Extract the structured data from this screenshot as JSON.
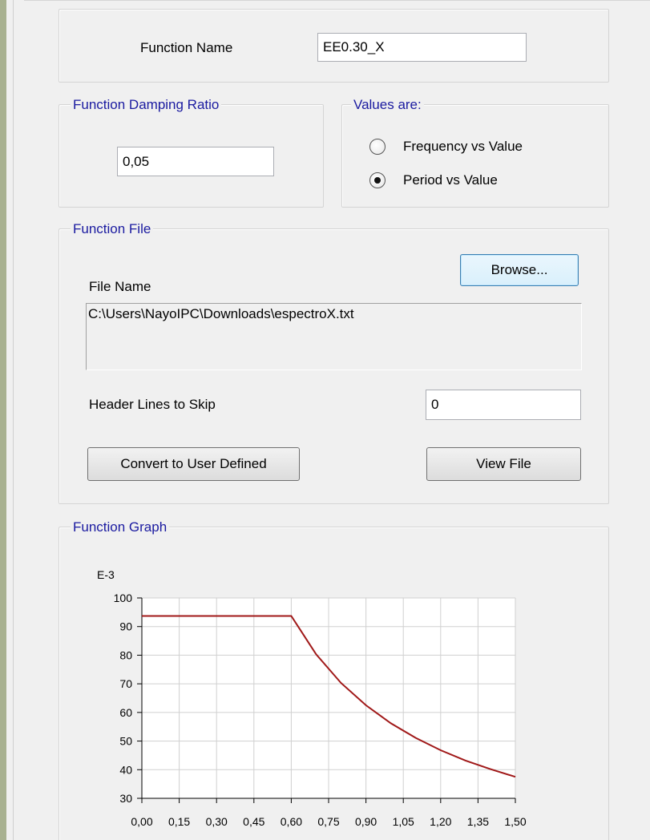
{
  "function_name": {
    "label": "Function Name",
    "value": "EE0.30_X"
  },
  "damping": {
    "title": "Function Damping Ratio",
    "value": "0,05"
  },
  "values_are": {
    "title": "Values are:",
    "options": [
      {
        "label": "Frequency vs Value",
        "selected": false
      },
      {
        "label": "Period vs Value",
        "selected": true
      }
    ]
  },
  "function_file": {
    "title": "Function File",
    "browse_label": "Browse...",
    "file_name_label": "File Name",
    "file_name_value": "C:\\Users\\NayoIPC\\Downloads\\espectroX.txt",
    "header_lines_label": "Header Lines to Skip",
    "header_lines_value": "0",
    "convert_label": "Convert to User Defined",
    "view_file_label": "View File"
  },
  "function_graph": {
    "title": "Function Graph"
  },
  "chart_data": {
    "type": "line",
    "scale_label": "E-3",
    "x_ticks": [
      "0,00",
      "0,15",
      "0,30",
      "0,45",
      "0,60",
      "0,75",
      "0,90",
      "1,05",
      "1,20",
      "1,35",
      "1,50"
    ],
    "x_tick_values": [
      0,
      0.15,
      0.3,
      0.45,
      0.6,
      0.75,
      0.9,
      1.05,
      1.2,
      1.35,
      1.5
    ],
    "y_ticks": [
      "100",
      "90",
      "80",
      "70",
      "60",
      "50",
      "40",
      "30"
    ],
    "y_tick_values": [
      100,
      90,
      80,
      70,
      60,
      50,
      40,
      30
    ],
    "xlim": [
      0,
      1.5
    ],
    "ylim": [
      30,
      100
    ],
    "grid": true,
    "line_color": "#a01818",
    "series": [
      {
        "x": [
          0,
          0.6,
          0.7,
          0.8,
          0.9,
          1.0,
          1.1,
          1.2,
          1.3,
          1.4,
          1.5
        ],
        "values": [
          93.7,
          93.7,
          80.3,
          70.3,
          62.5,
          56.2,
          51.1,
          46.8,
          43.2,
          40.2,
          37.5
        ]
      }
    ]
  }
}
